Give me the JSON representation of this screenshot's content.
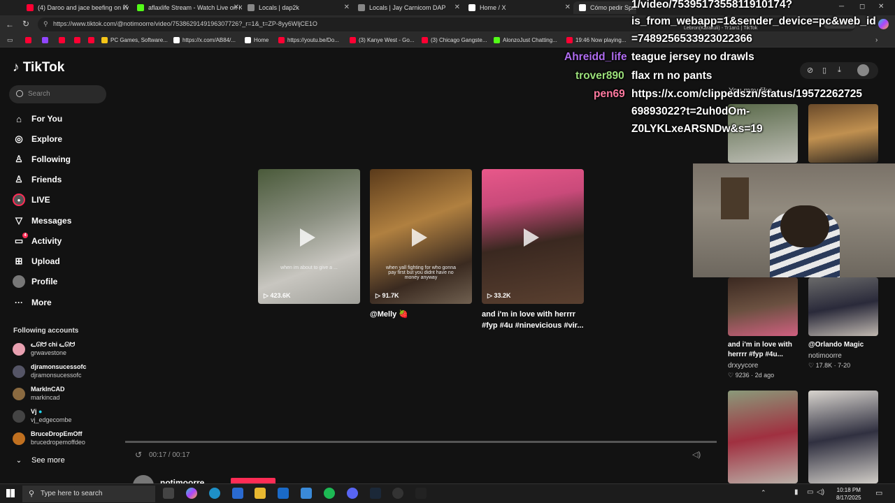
{
  "browser": {
    "tabs": [
      {
        "title": "(4) Daroo and jace beefing on liv",
        "color": "#ff0033"
      },
      {
        "title": "aflaxlife Stream - Watch Live on K",
        "color": "#53fc18"
      },
      {
        "title": "Locals | dap2k",
        "color": "#888888"
      },
      {
        "title": "Locals | Jay Carnicom DAP",
        "color": "#888888"
      },
      {
        "title": "Home / X",
        "color": "#ffffff"
      },
      {
        "title": "Cómo pedir Sprite",
        "color": "#ffffff"
      }
    ],
    "url": "https://www.tiktok.com/@notimoorre/video/7538629149196307726?_r=1&_t=ZP-8yy6WljCE1O",
    "bookmarks": [
      {
        "label": "PC Games, Software...",
        "color": "#f5c518"
      },
      {
        "label": "https://x.com/AB84/...",
        "color": "#ffffff"
      },
      {
        "label": "Home",
        "color": "#ffffff"
      },
      {
        "label": "https://youtu.be/Do...",
        "color": "#ff0033"
      },
      {
        "label": "(3) Kanye West - Go...",
        "color": "#ff0033"
      },
      {
        "label": "(3) Chicago Gangste...",
        "color": "#ff0033"
      },
      {
        "label": "AlonzoJust Chatting...",
        "color": "#53fc18"
      },
      {
        "label": "19:46 Now playing...",
        "color": "#ff0033"
      }
    ],
    "overlay_tab_text": "Lebron(Karakuli) - Tr1an1 | TikTok"
  },
  "sidebar": {
    "logo": "TikTok",
    "search_placeholder": "Search",
    "nav": [
      {
        "label": "For You",
        "icon": "home-icon",
        "glyph": "⌂"
      },
      {
        "label": "Explore",
        "icon": "compass-icon",
        "glyph": "◎"
      },
      {
        "label": "Following",
        "icon": "following-icon",
        "glyph": "♙"
      },
      {
        "label": "Friends",
        "icon": "friends-icon",
        "glyph": "♙"
      },
      {
        "label": "LIVE",
        "icon": "live-icon",
        "glyph": "●"
      },
      {
        "label": "Messages",
        "icon": "messages-icon",
        "glyph": "▽"
      },
      {
        "label": "Activity",
        "icon": "activity-icon",
        "glyph": "▭",
        "badge": "4"
      },
      {
        "label": "Upload",
        "icon": "upload-icon",
        "glyph": "⊞"
      },
      {
        "label": "Profile",
        "icon": "profile-icon",
        "glyph": "●"
      },
      {
        "label": "More",
        "icon": "more-icon",
        "glyph": "···"
      }
    ],
    "following_title": "Following accounts",
    "accounts": [
      {
        "name": "ᓚᘏᗢ chi ᓚᘏᗢ",
        "handle": "grwavestone",
        "color": "#e8a0b0"
      },
      {
        "name": "djramonsucessofc",
        "handle": "djramonsucessofc",
        "color": "#556"
      },
      {
        "name": "MarkInCAD",
        "handle": "markincad",
        "color": "#8a6a40"
      },
      {
        "name": "Vj",
        "handle": "vj_edgecombe",
        "color": "#444"
      },
      {
        "name": "BruceDropEmOff",
        "handle": "brucedropemoffdeo",
        "color": "#c07020"
      }
    ],
    "see_more": "See more"
  },
  "videos": [
    {
      "views": "423.6K",
      "overlay": "when im about to give a ...",
      "caption": ""
    },
    {
      "views": "91.7K",
      "overlay": "when yall fighting for who gonna pay first but you didnt have no money anyway",
      "caption": "@Melly 🍓"
    },
    {
      "views": "33.2K",
      "overlay": "",
      "caption": "and i'm in love with herrrr #fyp #4u #ninevicious #vir..."
    }
  ],
  "player": {
    "time": "00:17 / 00:17",
    "progress": 1.0,
    "author": "notimoorre"
  },
  "right_column": {
    "title": "You may like",
    "items": [
      {
        "caption": "and i'm in love with herrrr #fyp #4u...",
        "user": "drxyycore",
        "stats": "♡ 9236 · 2d ago"
      },
      {
        "caption": "@Orlando Magic",
        "user": "notimoorre",
        "stats": "♡ 17.8K · 7-20"
      }
    ]
  },
  "chat": [
    {
      "user": "",
      "text": "1/video/7539517355811910174?",
      "color": "#ffffff"
    },
    {
      "user": "",
      "text": "is_from_webapp=1&sender_device=pc&web_id",
      "color": "#ffffff"
    },
    {
      "user": "",
      "text": "=7489256533923022366",
      "color": "#ffffff"
    },
    {
      "user": "Ahreidd_life",
      "text": "teague jersey no drawls",
      "color": "#b06cf0"
    },
    {
      "user": "trover890",
      "text": "flax rn no pants",
      "color": "#9be07a"
    },
    {
      "user": "pen69",
      "text": "https://x.com/clippedszn/status/19572262725",
      "color": "#ff7aa0"
    },
    {
      "user": "",
      "text": "69893022?t=2uh0dOm-",
      "color": "#ffffff"
    },
    {
      "user": "",
      "text": "Z0LYKLxeARSNDw&s=19",
      "color": "#ffffff"
    }
  ],
  "taskbar": {
    "search_placeholder": "Type here to search",
    "time": "10:18 PM",
    "date": "8/17/2025"
  }
}
